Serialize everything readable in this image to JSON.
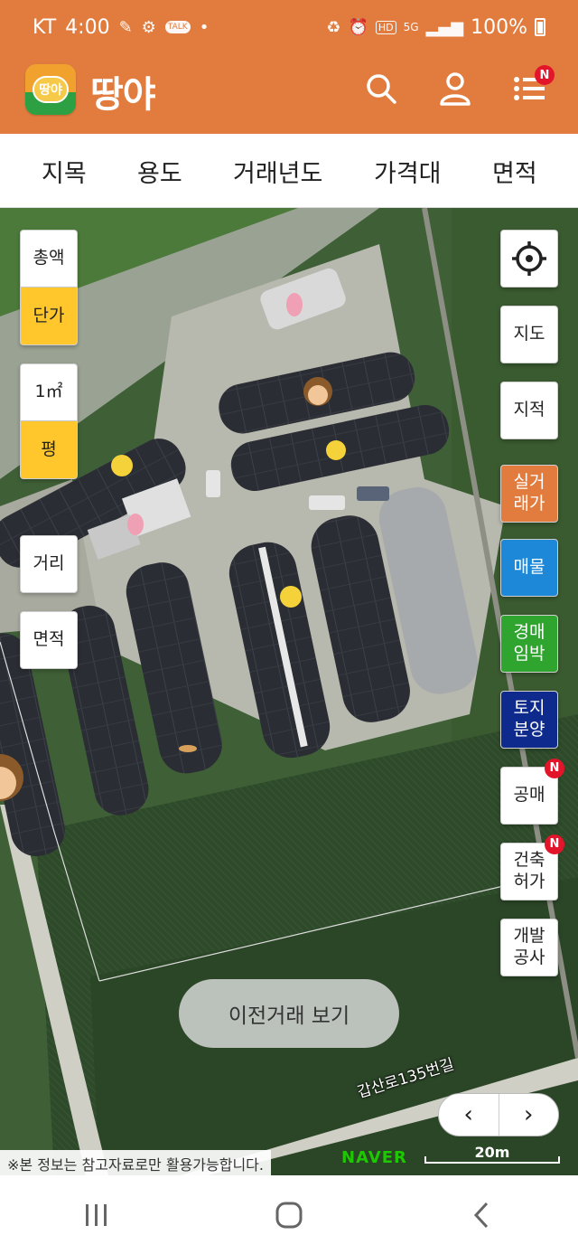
{
  "status_bar": {
    "carrier": "KT",
    "time": "4:00",
    "battery": "100%",
    "network": "5G",
    "hd_badge": "HD",
    "kakao_badge": "TALK"
  },
  "header": {
    "logo_badge_text": "땅야",
    "app_title": "땅야",
    "menu_badge": "N"
  },
  "filters": [
    "지목",
    "용도",
    "거래년도",
    "가격대",
    "면적"
  ],
  "left_controls": {
    "total_price": "총액",
    "unit_price": "단가",
    "unit_m2": "1㎡",
    "unit_pyeong": "평",
    "distance": "거리",
    "area": "면적"
  },
  "right_controls": {
    "location_icon": "crosshair-icon",
    "map": "지도",
    "cadastral": "지적",
    "actual_price": [
      "실거",
      "래가"
    ],
    "listing": "매물",
    "auction": [
      "경매",
      "임박"
    ],
    "land_sale": [
      "토지",
      "분양"
    ],
    "public_sale": "공매",
    "public_sale_badge": "N",
    "building_permit": [
      "건축",
      "허가"
    ],
    "building_permit_badge": "N",
    "development": [
      "개발",
      "공사"
    ]
  },
  "map": {
    "prev_deals_button": "이전거래 보기",
    "road_label": "갑산로135번길",
    "notice": "※본 정보는 참고자료로만 활용가능합니다.",
    "naver_logo": "NAVER",
    "scale": "20m",
    "pager_prev": "‹",
    "pager_next": "›"
  },
  "colors": {
    "brand_orange": "#E27C3E",
    "unit_selected": "#FFC72C",
    "listing_blue": "#1E88D8",
    "auction_green": "#2FA52F",
    "land_sale_navy": "#0D2A8C",
    "badge_red": "#E3152B"
  }
}
